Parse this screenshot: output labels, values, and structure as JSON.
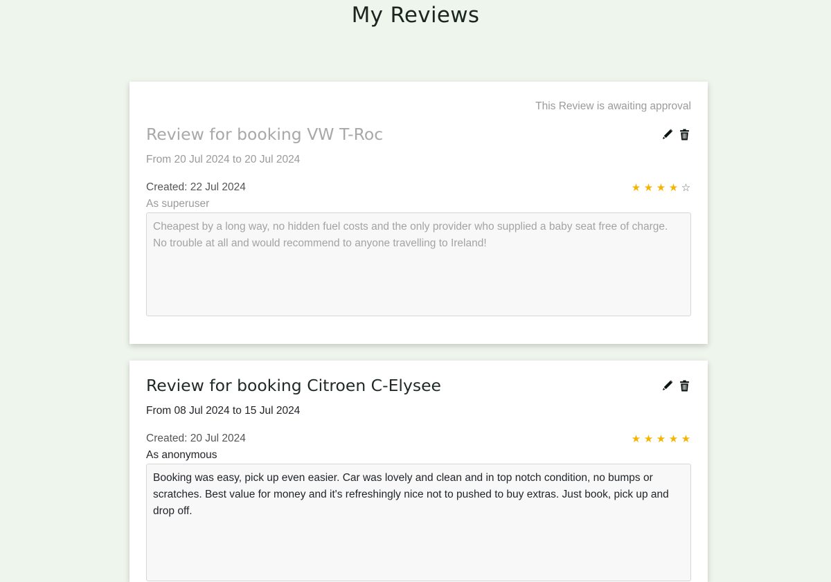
{
  "page_title": "My Reviews",
  "icons": {
    "edit": "pencil-icon",
    "delete": "trash-icon"
  },
  "colors": {
    "star_filled": "#f6b400",
    "star_empty": "#6c6c6c",
    "background": "#eef5ec"
  },
  "reviews": [
    {
      "status": "This Review is awaiting approval",
      "title": "Review for booking VW T-Roc",
      "dates": "From 20 Jul 2024 to 20 Jul 2024",
      "created": "Created: 22 Jul 2024",
      "rating": 4,
      "rating_max": 5,
      "author": "As superuser",
      "text": "Cheapest by a long way, no hidden fuel costs and the only provider who supplied a baby seat free of charge. No trouble at all and would recommend to anyone travelling to Ireland!"
    },
    {
      "title": "Review for booking Citroen C-Elysee",
      "dates": "From 08 Jul 2024 to 15 Jul 2024",
      "created": "Created: 20 Jul 2024",
      "rating": 5,
      "rating_max": 5,
      "author": "As anonymous",
      "text": "Booking was easy, pick up even easier. Car was lovely and clean and in top notch condition, no bumps or scratches. Best value for money and it's refreshingly nice not to pushed to buy extras. Just book, pick up and drop off."
    }
  ]
}
